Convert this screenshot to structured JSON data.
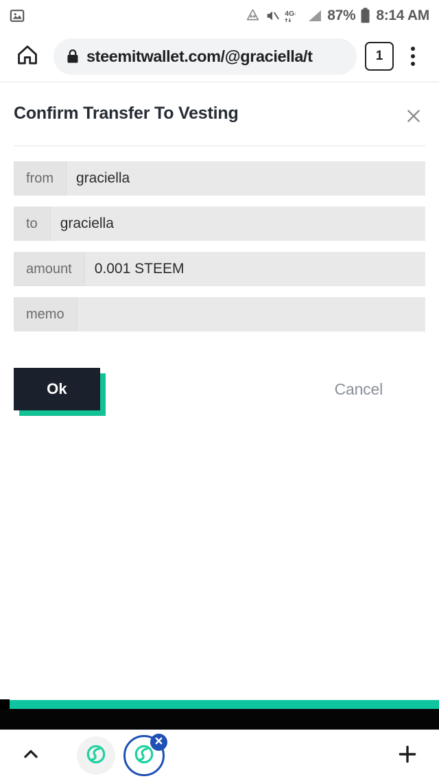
{
  "statusbar": {
    "notification_icon": "image-icon",
    "icons": [
      {
        "name": "data-saver-icon"
      },
      {
        "name": "volume-mute-icon"
      },
      {
        "name": "lte-4g-icon",
        "label": "4G"
      },
      {
        "name": "signal-bars-icon"
      }
    ],
    "battery_percent": "87%",
    "battery_icon": "battery-icon",
    "time": "8:14 AM"
  },
  "toolbar": {
    "home_icon": "home-icon",
    "lock_icon": "lock-icon",
    "url": "steemitwallet.com/@graciella/t",
    "url_placeholder": "Search or type web address",
    "tab_count": "1",
    "menu_icon": "overflow-menu-icon"
  },
  "dialog": {
    "title": "Confirm Transfer To Vesting",
    "close_icon": "close-icon",
    "rows": [
      {
        "label": "from",
        "value": "graciella"
      },
      {
        "label": "to",
        "value": "graciella"
      },
      {
        "label": "amount",
        "value": "0.001 STEEM"
      },
      {
        "label": "memo",
        "value": ""
      }
    ],
    "ok_label": "Ok",
    "cancel_label": "Cancel"
  },
  "footer": {
    "strip_text": "",
    "teal_color": "#0fc5a0",
    "black_color": "#050505"
  },
  "bottombar": {
    "chevron_icon": "chevron-up-icon",
    "tabs": [
      {
        "name": "steem-tab-inactive",
        "icon": "steem-logo-icon",
        "active": false
      },
      {
        "name": "steem-tab-active",
        "icon": "steem-logo-icon",
        "active": true,
        "close_icon": "close-badge-icon"
      }
    ],
    "plus_icon": "plus-icon"
  },
  "colors": {
    "accent_teal": "#0fc5a0",
    "button_dark": "#1a202c",
    "badge_blue": "#1e50b5",
    "field_gray": "#e9e9e9"
  }
}
